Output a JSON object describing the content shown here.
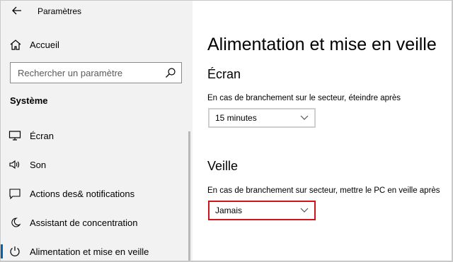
{
  "window": {
    "title": "Paramètres"
  },
  "sidebar": {
    "home_label": "Accueil",
    "search_placeholder": "Rechercher un paramètre",
    "section_title": "Système",
    "items": [
      {
        "label": "Écran",
        "icon": "monitor-icon"
      },
      {
        "label": "Son",
        "icon": "speaker-icon"
      },
      {
        "label": "Actions des& notifications",
        "icon": "notification-icon"
      },
      {
        "label": "Assistant de concentration",
        "icon": "moon-icon"
      },
      {
        "label": "Alimentation et mise en veille",
        "icon": "power-icon",
        "active": true
      }
    ]
  },
  "main": {
    "page_title": "Alimentation et mise en veille",
    "screen": {
      "heading": "Écran",
      "description": "En cas de branchement sur le secteur, éteindre après",
      "value": "15 minutes"
    },
    "sleep": {
      "heading": "Veille",
      "description": "En cas de branchement sur secteur, mettre le PC en veille après",
      "value": "Jamais"
    }
  },
  "colors": {
    "accent": "#0063b1",
    "highlight": "#d0121b",
    "sidebar_bg": "#f2f2f2"
  }
}
